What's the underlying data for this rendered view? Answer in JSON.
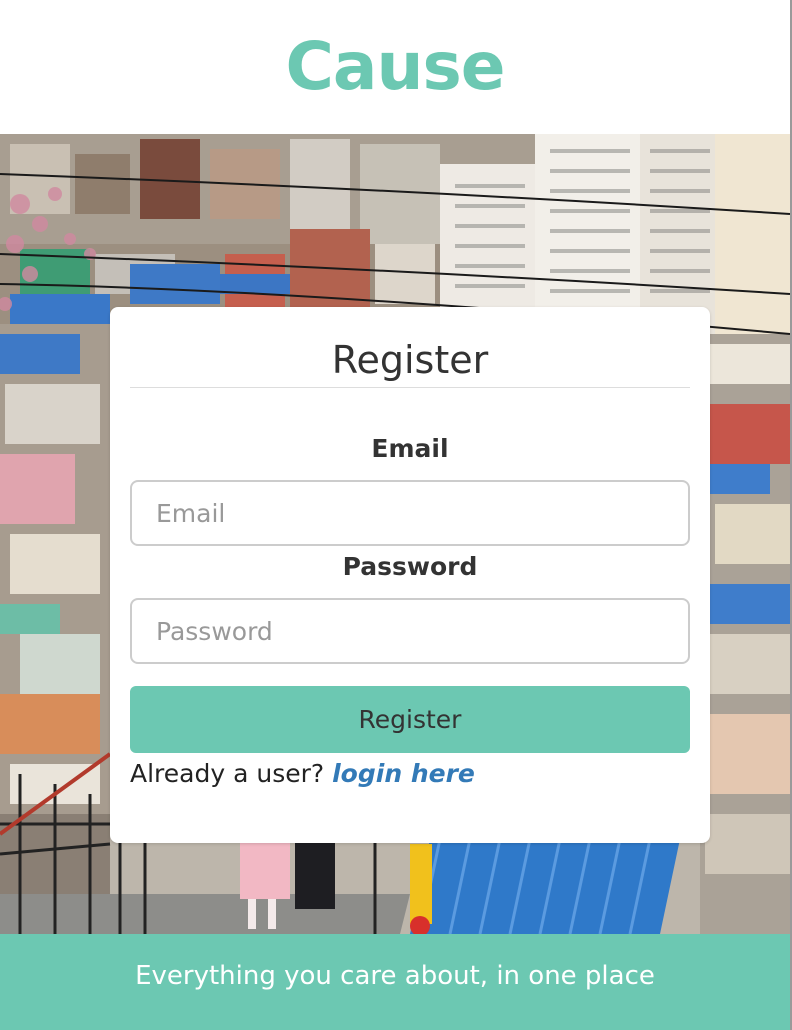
{
  "brand": {
    "name": "Cause"
  },
  "register_form": {
    "title": "Register",
    "email_label": "Email",
    "email_placeholder": "Email",
    "email_value": "",
    "password_label": "Password",
    "password_placeholder": "Password",
    "password_value": "",
    "submit_label": "Register",
    "login_prompt": "Already a user?",
    "login_link": "login here"
  },
  "footer": {
    "tagline": "Everything you care about, in one place"
  },
  "colors": {
    "accent": "#6cc8b2",
    "link": "#337ab7",
    "text": "#333333"
  }
}
